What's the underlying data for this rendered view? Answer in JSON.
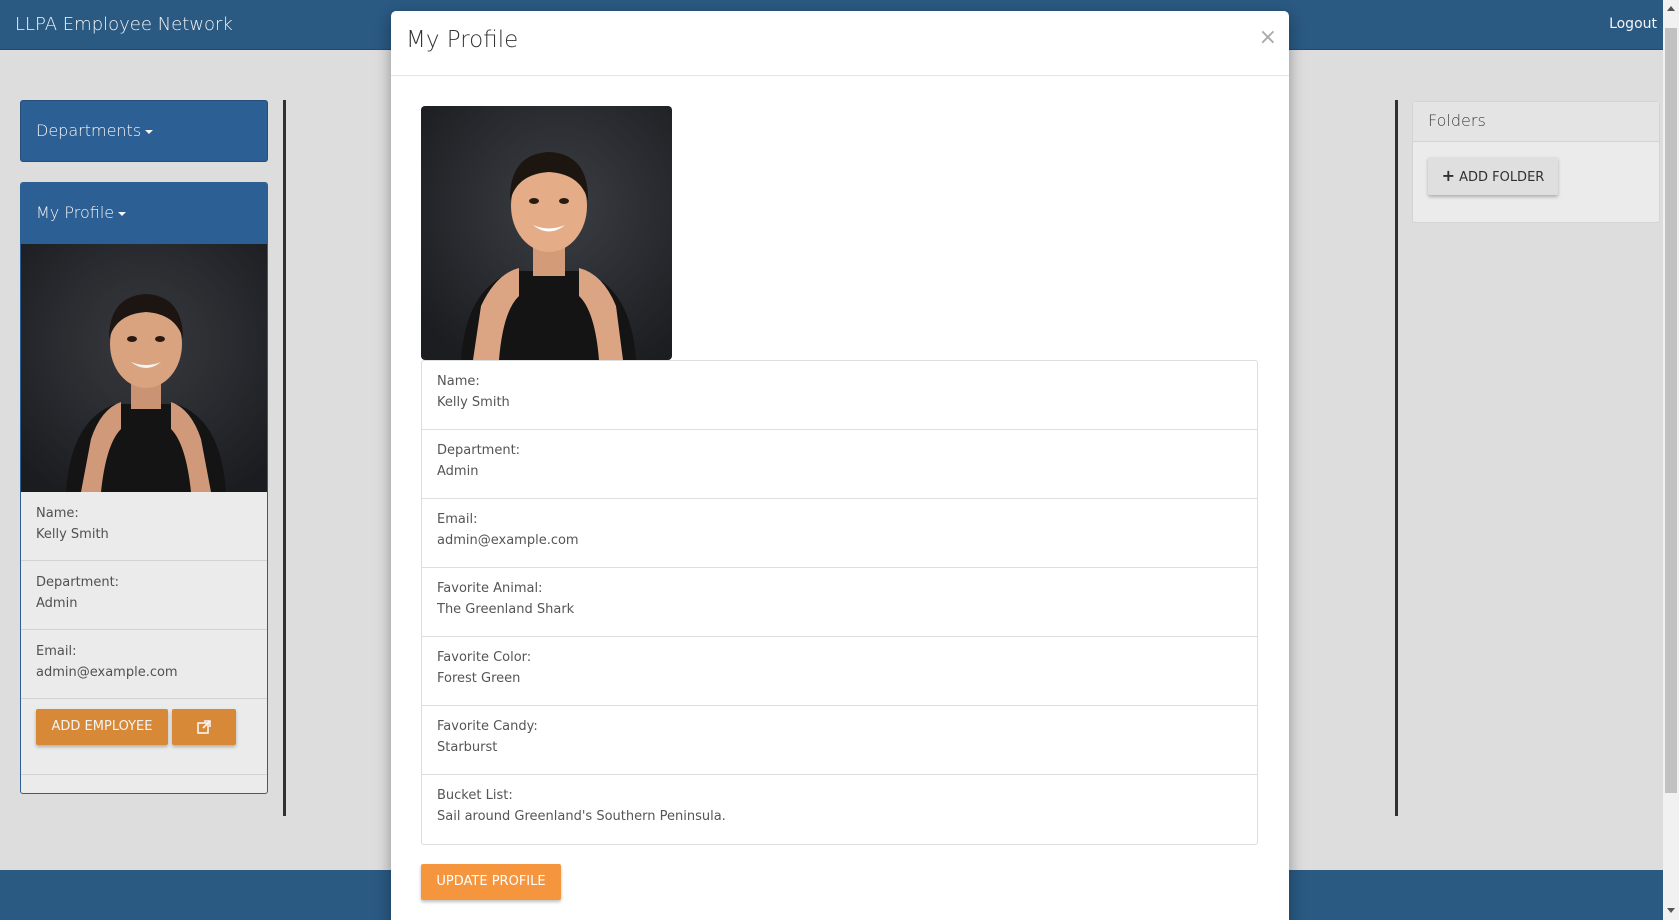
{
  "navbar": {
    "brand": "LLPA Employee Network",
    "logout": "Logout"
  },
  "sidebar": {
    "departments_label": "Departments",
    "profile_label": "My Profile",
    "fields": [
      {
        "label": "Name:",
        "value": "Kelly Smith"
      },
      {
        "label": "Department:",
        "value": "Admin"
      },
      {
        "label": "Email:",
        "value": "admin@example.com"
      }
    ],
    "add_employee": "ADD EMPLOYEE",
    "edit_icon": "external-link-icon"
  },
  "folders": {
    "title": "Folders",
    "add_folder": "ADD FOLDER"
  },
  "modal": {
    "title": "My Profile",
    "close": "×",
    "fields": [
      {
        "label": "Name:",
        "value": "Kelly Smith"
      },
      {
        "label": "Department:",
        "value": "Admin"
      },
      {
        "label": "Email:",
        "value": "admin@example.com"
      },
      {
        "label": "Favorite Animal:",
        "value": "The Greenland Shark"
      },
      {
        "label": "Favorite Color:",
        "value": "Forest Green"
      },
      {
        "label": "Favorite Candy:",
        "value": "Starburst"
      },
      {
        "label": "Bucket List:",
        "value": "Sail around Greenland's Southern Peninsula."
      }
    ],
    "update_button": "UPDATE PROFILE"
  },
  "colors": {
    "navbar": "#2c5d88",
    "panel_blue": "#2e6399",
    "orange": "#e08f3b",
    "update_orange": "#f5963e"
  }
}
